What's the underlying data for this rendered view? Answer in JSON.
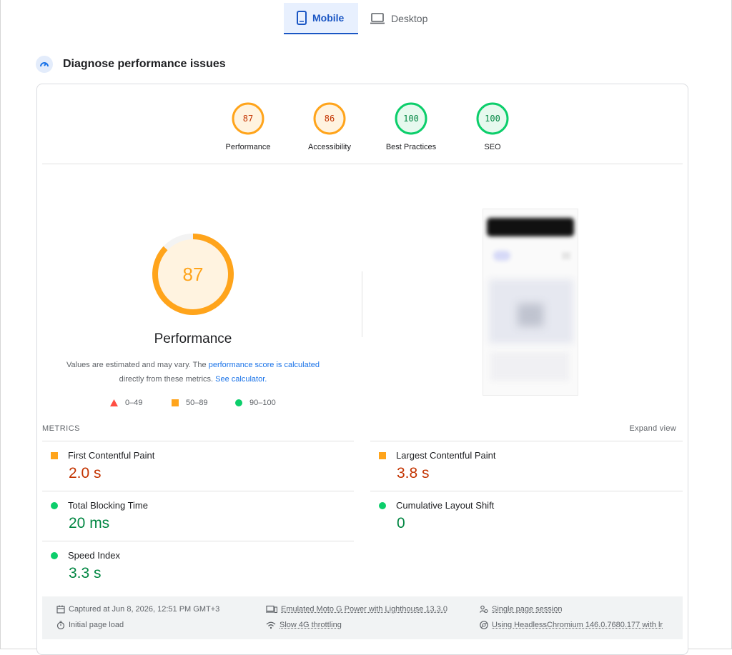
{
  "tabs": [
    {
      "label": "Mobile",
      "icon": "mobile-icon",
      "active": true
    },
    {
      "label": "Desktop",
      "icon": "desktop-icon",
      "active": false
    }
  ],
  "diagnose": {
    "title": "Diagnose performance issues",
    "icon": "gauge-icon"
  },
  "categories": [
    {
      "score": "87",
      "label": "Performance",
      "level": "average"
    },
    {
      "score": "86",
      "label": "Accessibility",
      "level": "average"
    },
    {
      "score": "100",
      "label": "Best Practices",
      "level": "pass"
    },
    {
      "score": "100",
      "label": "SEO",
      "level": "pass"
    }
  ],
  "performance": {
    "score": "87",
    "score_fraction": 0.87,
    "label": "Performance",
    "note_prefix": "Values are estimated and may vary. The ",
    "note_link": "performance score is calculated",
    "note_mid": " directly from these metrics. ",
    "note_link2": "See calculator.",
    "legend": [
      {
        "shape": "triangle",
        "range": "0–49",
        "color": "#ff4e42"
      },
      {
        "shape": "square",
        "range": "50–89",
        "color": "#ffa41b"
      },
      {
        "shape": "circle",
        "range": "90–100",
        "color": "#0cce6b"
      }
    ]
  },
  "metrics": {
    "heading": "METRICS",
    "expand_label": "Expand view",
    "items": [
      {
        "label": "First Contentful Paint",
        "value": "2.0 s",
        "level": "average"
      },
      {
        "label": "Largest Contentful Paint",
        "value": "3.8 s",
        "level": "average"
      },
      {
        "label": "Total Blocking Time",
        "value": "20 ms",
        "level": "pass"
      },
      {
        "label": "Cumulative Layout Shift",
        "value": "0",
        "level": "pass"
      },
      {
        "label": "Speed Index",
        "value": "3.3 s",
        "level": "pass"
      }
    ]
  },
  "footer": {
    "captured": "Captured at Jun 8, 2026, 12:51 PM GMT+3",
    "load": "Initial page load",
    "device": "Emulated Moto G Power with Lighthouse 13.3.0",
    "throttling": "Slow 4G throttling",
    "session": "Single page session",
    "browser": "Using HeadlessChromium 146.0.7680.177 with lr"
  },
  "colors": {
    "accent": "#1a56c4",
    "average": "#ffa41b",
    "average_text": "#c33300",
    "pass": "#0cce6b",
    "pass_text": "#018642",
    "fail": "#ff4e42"
  }
}
